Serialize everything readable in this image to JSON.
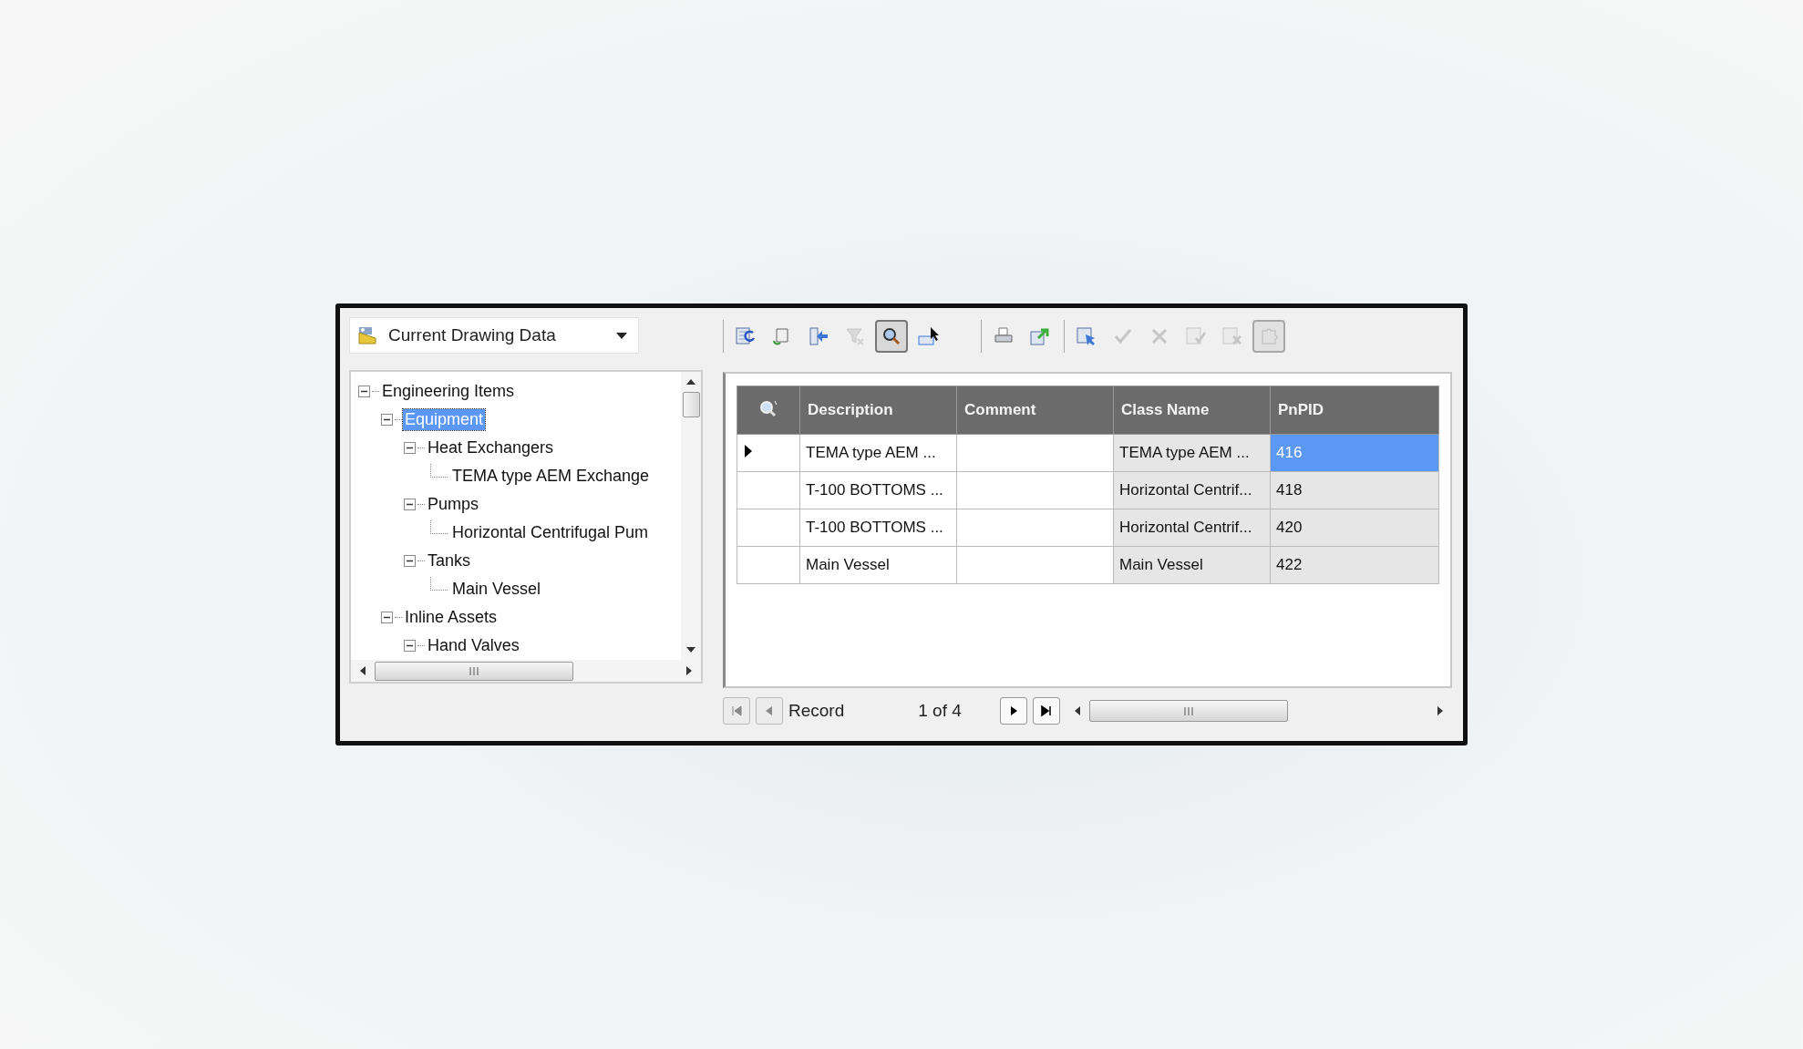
{
  "source_dropdown": {
    "value": "Current Drawing Data"
  },
  "tree": [
    {
      "label": "Engineering Items",
      "selected": false,
      "expanded": true,
      "children": [
        {
          "label": "Equipment",
          "selected": true,
          "expanded": true,
          "children": [
            {
              "label": "Heat Exchangers",
              "selected": false,
              "expanded": true,
              "children": [
                {
                  "label": "TEMA type AEM Exchange",
                  "selected": false
                }
              ]
            },
            {
              "label": "Pumps",
              "selected": false,
              "expanded": true,
              "children": [
                {
                  "label": "Horizontal Centrifugal Pum",
                  "selected": false
                }
              ]
            },
            {
              "label": "Tanks",
              "selected": false,
              "expanded": true,
              "children": [
                {
                  "label": "Main Vessel",
                  "selected": false
                }
              ]
            }
          ]
        },
        {
          "label": "Inline Assets",
          "selected": false,
          "expanded": true,
          "children": [
            {
              "label": "Hand Valves",
              "selected": false,
              "expanded": true
            }
          ]
        }
      ]
    }
  ],
  "toolbar": [
    [
      {
        "disabled": false,
        "pressed": false
      },
      {
        "disabled": false,
        "pressed": false
      },
      {
        "disabled": false,
        "pressed": false
      },
      {
        "disabled": true,
        "pressed": false
      },
      {
        "disabled": false,
        "pressed": true
      },
      {
        "disabled": false,
        "pressed": false
      }
    ],
    [
      {
        "disabled": false,
        "pressed": false
      },
      {
        "disabled": false,
        "pressed": false
      }
    ],
    [
      {
        "disabled": false,
        "pressed": false
      },
      {
        "disabled": true,
        "pressed": false
      },
      {
        "disabled": true,
        "pressed": false
      },
      {
        "disabled": true,
        "pressed": false
      },
      {
        "disabled": true,
        "pressed": false
      },
      {
        "disabled": true,
        "pressed": true
      }
    ]
  ],
  "grid": {
    "columns": [
      {
        "label": "Description",
        "readonly": false
      },
      {
        "label": "Comment",
        "readonly": false
      },
      {
        "label": "Class Name",
        "readonly": true
      },
      {
        "label": "PnPID",
        "readonly": true
      }
    ],
    "rows": [
      {
        "current": true,
        "cells": [
          {
            "text": "TEMA type AEM ...",
            "selected": false
          },
          {
            "selected": false
          },
          {
            "text": "TEMA type AEM ...",
            "selected": false
          },
          {
            "text": "416",
            "selected": true
          }
        ]
      },
      {
        "current": false,
        "cells": [
          {
            "text": "T-100 BOTTOMS ...",
            "selected": false
          },
          {
            "selected": false
          },
          {
            "text": "Horizontal Centrif...",
            "selected": false
          },
          {
            "text": "418",
            "selected": false
          }
        ]
      },
      {
        "current": false,
        "cells": [
          {
            "text": "T-100 BOTTOMS ...",
            "selected": false
          },
          {
            "selected": false
          },
          {
            "text": "Horizontal Centrif...",
            "selected": false
          },
          {
            "text": "420",
            "selected": false
          }
        ]
      },
      {
        "current": false,
        "cells": [
          {
            "text": "Main Vessel",
            "selected": false
          },
          {
            "selected": false
          },
          {
            "text": "Main Vessel",
            "selected": false
          },
          {
            "text": "422",
            "selected": false
          }
        ]
      }
    ]
  },
  "navigator": {
    "label": "Record",
    "position": "1 of 4",
    "buttons": [
      {
        "disabled": true
      },
      {
        "disabled": true
      },
      {
        "disabled": false
      },
      {
        "disabled": false
      }
    ]
  }
}
